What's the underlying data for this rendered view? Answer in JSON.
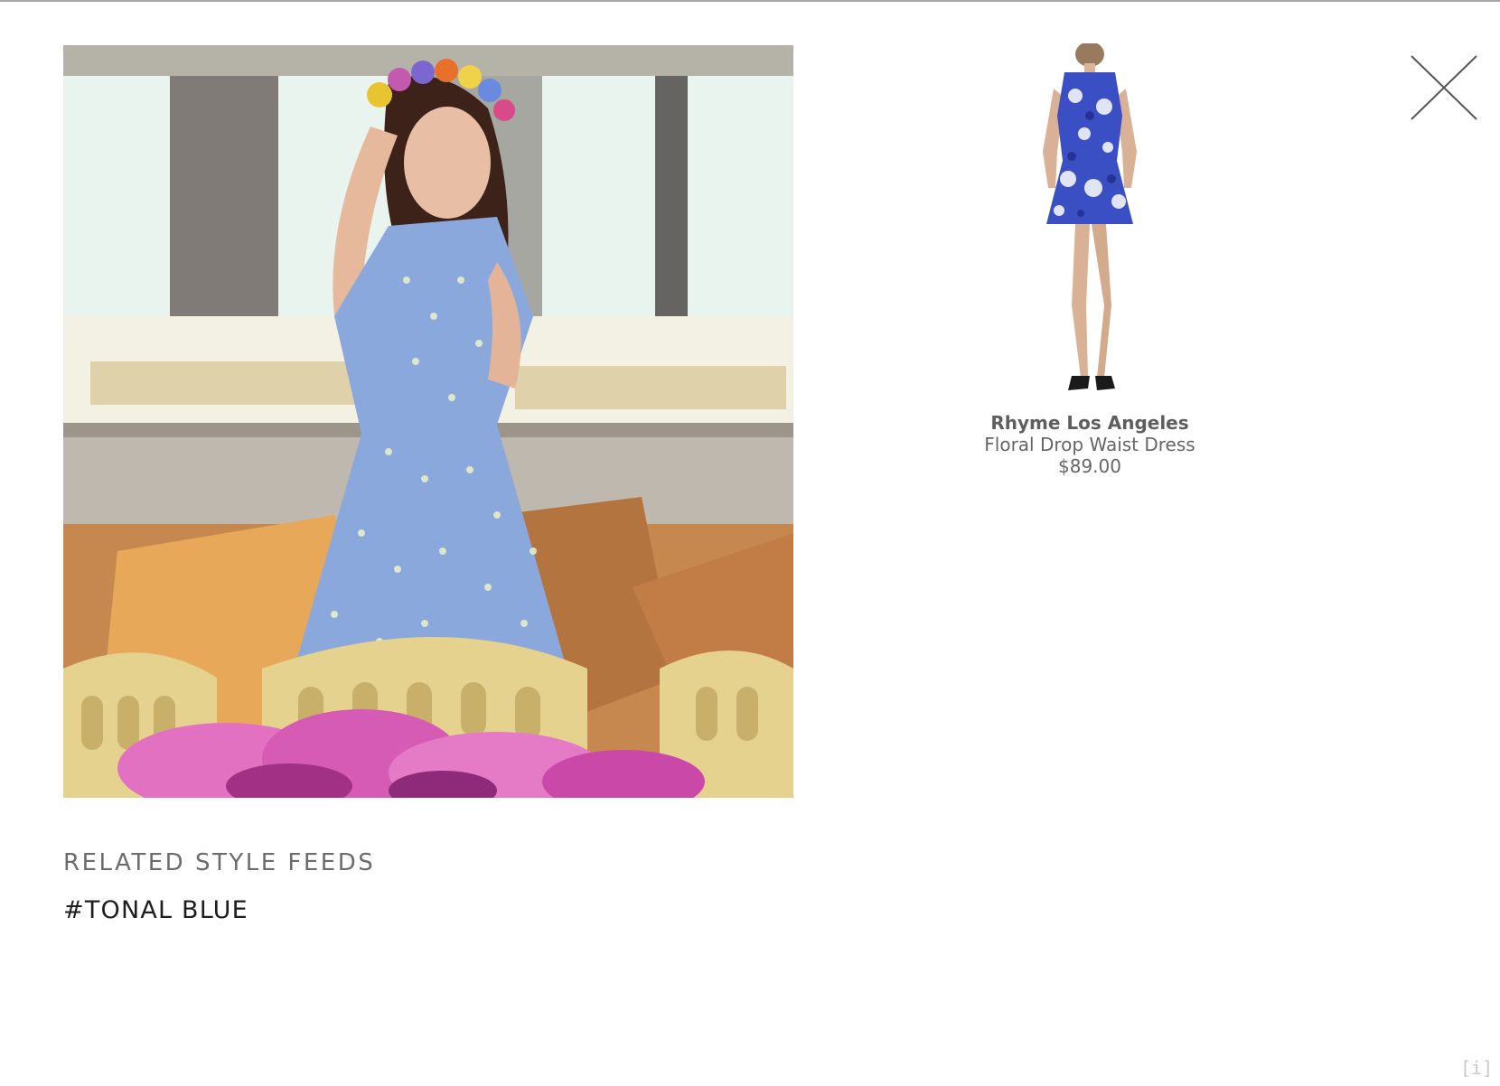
{
  "modal": {
    "close_icon": "close-x-icon",
    "photo": {
      "subject": "woman in light blue polka-dot dress with flower crown",
      "colors": {
        "dress": "#7f9fd6",
        "wall": "#e5efe9",
        "sofa": "#c38a5c",
        "chairs": "#e0c781",
        "flowers": "#d65bb5"
      }
    }
  },
  "product": {
    "brand": "Rhyme Los Angeles",
    "name": "Floral Drop Waist Dress",
    "price": "$89.00",
    "image_colors": {
      "dress": "#3a4fc4",
      "print": "#ffffff"
    }
  },
  "related": {
    "heading": "RELATED STYLE FEEDS",
    "feeds": [
      {
        "label": "#TONAL BLUE"
      }
    ]
  },
  "footer": {
    "info_label": "[i]"
  }
}
